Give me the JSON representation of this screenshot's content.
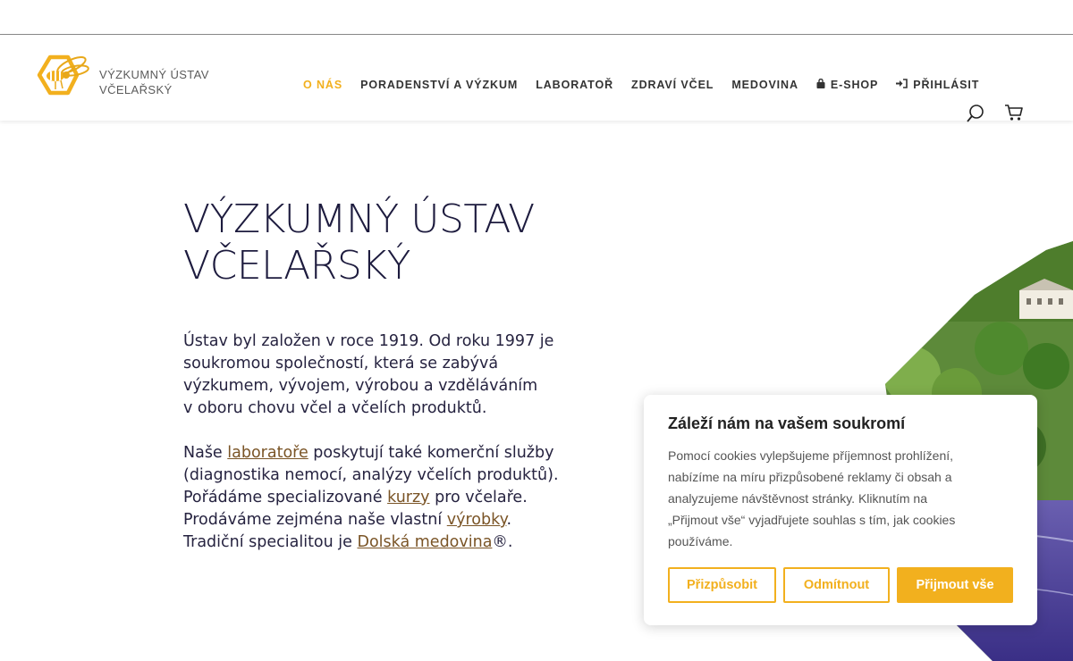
{
  "brand": {
    "line1": "VÝZKUMNÝ ÚSTAV",
    "line2": "VČELAŘSKÝ"
  },
  "nav": {
    "about": "O NÁS",
    "advice": "PORADENSTVÍ A VÝZKUM",
    "lab": "LABORATOŘ",
    "health": "ZDRAVÍ VČEL",
    "mead": "MEDOVINA",
    "eshop": "E-SHOP",
    "login": "PŘIHLÁSIT",
    "active_color": "#f2b01e"
  },
  "hero": {
    "title_line1": "VÝZKUMNÝ ÚSTAV",
    "title_line2": "VČELAŘSKÝ",
    "p1": [
      "Ústav byl založen v roce 1919. Od roku 1997 je",
      "soukromou společností, která se zabývá",
      "výzkumem, vývojem, výrobou a vzděláváním",
      "v oboru chovu včel a včelích produktů."
    ],
    "p2": {
      "l1_pre": "Naše ",
      "l1_link": "laboratoře",
      "l1_post": " poskytují také komerční služby",
      "l2": "(diagnostika nemocí, analýzy včelích produktů).",
      "l3_pre": "Pořádáme specializované ",
      "l3_link": "kurzy",
      "l3_post": " pro včelaře.",
      "l4_pre": "Prodáváme zejména naše vlastní ",
      "l4_link": "výrobky",
      "l4_post": ".",
      "l5_pre": "Tradiční specialitou je ",
      "l5_link": "Dolská medovina",
      "l5_post": "®."
    }
  },
  "cookie": {
    "title": "Záleží nám na vašem soukromí",
    "text": [
      "Pomocí cookies vylepšujeme příjemnost prohlížení,",
      "nabízíme na míru přizpůsobené reklamy či obsah a",
      "analyzujeme návštěvnost stránky. Kliknutím na",
      "„Přijmout vše“ vyjadřujete souhlas s tím, jak cookies",
      "používáme."
    ],
    "customize": "Přizpůsobit",
    "reject": "Odmítnout",
    "accept": "Přijmout vše",
    "accent": "#f2b01e"
  },
  "icons": {
    "logo": "bee-hexagon-logo",
    "eshop": "shopping-bag-icon",
    "login": "sign-in-icon",
    "search": "search-icon",
    "cart": "cart-icon"
  }
}
